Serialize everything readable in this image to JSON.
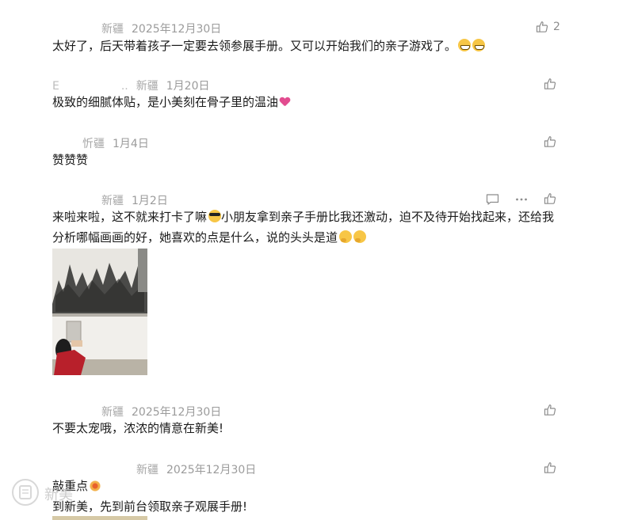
{
  "comments": [
    {
      "nick": "新疆",
      "date": "2025年12月30日",
      "like_count": "2",
      "text": "太好了，后天带着孩子一定要去领参展手册。又可以开始我们的亲子游戏了。"
    },
    {
      "nick_fragment": "E",
      "nick_ellipsis": "..",
      "nick": "新疆",
      "date": "1月20日",
      "text": "极致的细腻体贴，是小美刻在骨子里的温油"
    },
    {
      "nick": "忻疆",
      "date": "1月4日",
      "text": "赞赞赞"
    },
    {
      "nick": "新疆",
      "date": "1月2日",
      "text_part1": "来啦来啦，这不就来打卡了嘛",
      "text_part2": "小朋友拿到亲子手册比我还激动，迫不及待开始找起来，还给我",
      "text_line2": "分析哪幅画画的好，她喜欢的点是什么，说的头头是道",
      "image_alt": "child holding booklet in front of ink painting mural"
    },
    {
      "nick": "新疆",
      "date": "2025年12月30日",
      "text": "不要太宠哦，浓浓的情意在新美!"
    },
    {
      "nick": "新疆",
      "date": "2025年12月30日",
      "text_line1": "敲重点",
      "text_line2": "到新美，先到前台领取亲子观展手册!"
    }
  ],
  "icons": {
    "like": "thumbs-up-icon",
    "reply": "comment-bubble-icon",
    "more": "more-dots-icon"
  },
  "watermark": "新美"
}
